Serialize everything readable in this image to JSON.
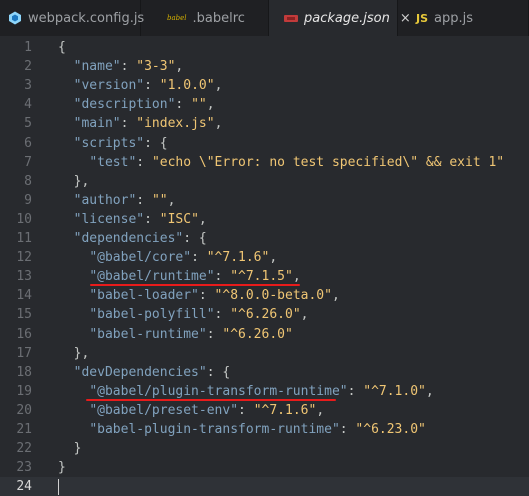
{
  "tabs": [
    {
      "label": "webpack.config.js",
      "icon": "webpack-icon",
      "active": false
    },
    {
      "label": ".babelrc",
      "icon": "babel-icon",
      "icon_text": "babel",
      "active": false
    },
    {
      "label": "package.json",
      "icon": "package-icon",
      "active": true,
      "close": "×"
    },
    {
      "label": "app.js",
      "icon": "js-icon",
      "icon_text": "JS",
      "active": false
    }
  ],
  "editor": {
    "current_line": 24,
    "lines": [
      {
        "n": "1",
        "parts": [
          [
            "p",
            "{"
          ]
        ]
      },
      {
        "n": "2",
        "parts": [
          [
            "p",
            "  "
          ],
          [
            "k",
            "\"name\""
          ],
          [
            "p",
            ": "
          ],
          [
            "s",
            "\"3-3\""
          ],
          [
            "p",
            ","
          ]
        ]
      },
      {
        "n": "3",
        "parts": [
          [
            "p",
            "  "
          ],
          [
            "k",
            "\"version\""
          ],
          [
            "p",
            ": "
          ],
          [
            "s",
            "\"1.0.0\""
          ],
          [
            "p",
            ","
          ]
        ]
      },
      {
        "n": "4",
        "parts": [
          [
            "p",
            "  "
          ],
          [
            "k",
            "\"description\""
          ],
          [
            "p",
            ": "
          ],
          [
            "s",
            "\"\""
          ],
          [
            "p",
            ","
          ]
        ]
      },
      {
        "n": "5",
        "parts": [
          [
            "p",
            "  "
          ],
          [
            "k",
            "\"main\""
          ],
          [
            "p",
            ": "
          ],
          [
            "s",
            "\"index.js\""
          ],
          [
            "p",
            ","
          ]
        ]
      },
      {
        "n": "6",
        "parts": [
          [
            "p",
            "  "
          ],
          [
            "k",
            "\"scripts\""
          ],
          [
            "p",
            ": {"
          ]
        ]
      },
      {
        "n": "7",
        "parts": [
          [
            "p",
            "    "
          ],
          [
            "k",
            "\"test\""
          ],
          [
            "p",
            ": "
          ],
          [
            "s",
            "\"echo \\\"Error: no test specified\\\" && exit 1\""
          ]
        ]
      },
      {
        "n": "8",
        "parts": [
          [
            "p",
            "  },"
          ]
        ]
      },
      {
        "n": "9",
        "parts": [
          [
            "p",
            "  "
          ],
          [
            "k",
            "\"author\""
          ],
          [
            "p",
            ": "
          ],
          [
            "s",
            "\"\""
          ],
          [
            "p",
            ","
          ]
        ]
      },
      {
        "n": "10",
        "parts": [
          [
            "p",
            "  "
          ],
          [
            "k",
            "\"license\""
          ],
          [
            "p",
            ": "
          ],
          [
            "s",
            "\"ISC\""
          ],
          [
            "p",
            ","
          ]
        ]
      },
      {
        "n": "11",
        "parts": [
          [
            "p",
            "  "
          ],
          [
            "k",
            "\"dependencies\""
          ],
          [
            "p",
            ": {"
          ]
        ]
      },
      {
        "n": "12",
        "parts": [
          [
            "p",
            "    "
          ],
          [
            "k",
            "\"@babel/core\""
          ],
          [
            "p",
            ": "
          ],
          [
            "s",
            "\"^7.1.6\""
          ],
          [
            "p",
            ","
          ]
        ]
      },
      {
        "n": "13",
        "parts": [
          [
            "p",
            "    "
          ],
          [
            "k",
            "\"@babel/runtime\""
          ],
          [
            "p",
            ": "
          ],
          [
            "s",
            "\"^7.1.5\""
          ],
          [
            "p",
            ","
          ]
        ]
      },
      {
        "n": "14",
        "parts": [
          [
            "p",
            "    "
          ],
          [
            "k",
            "\"babel-loader\""
          ],
          [
            "p",
            ": "
          ],
          [
            "s",
            "\"^8.0.0-beta.0\""
          ],
          [
            "p",
            ","
          ]
        ]
      },
      {
        "n": "15",
        "parts": [
          [
            "p",
            "    "
          ],
          [
            "k",
            "\"babel-polyfill\""
          ],
          [
            "p",
            ": "
          ],
          [
            "s",
            "\"^6.26.0\""
          ],
          [
            "p",
            ","
          ]
        ]
      },
      {
        "n": "16",
        "parts": [
          [
            "p",
            "    "
          ],
          [
            "k",
            "\"babel-runtime\""
          ],
          [
            "p",
            ": "
          ],
          [
            "s",
            "\"^6.26.0\""
          ]
        ]
      },
      {
        "n": "17",
        "parts": [
          [
            "p",
            "  },"
          ]
        ]
      },
      {
        "n": "18",
        "parts": [
          [
            "p",
            "  "
          ],
          [
            "k",
            "\"devDependencies\""
          ],
          [
            "p",
            ": {"
          ]
        ]
      },
      {
        "n": "19",
        "parts": [
          [
            "p",
            "    "
          ],
          [
            "k",
            "\"@babel/plugin-transform-runtime\""
          ],
          [
            "p",
            ": "
          ],
          [
            "s",
            "\"^7.1.0\""
          ],
          [
            "p",
            ","
          ]
        ]
      },
      {
        "n": "20",
        "parts": [
          [
            "p",
            "    "
          ],
          [
            "k",
            "\"@babel/preset-env\""
          ],
          [
            "p",
            ": "
          ],
          [
            "s",
            "\"^7.1.6\""
          ],
          [
            "p",
            ","
          ]
        ]
      },
      {
        "n": "21",
        "parts": [
          [
            "p",
            "    "
          ],
          [
            "k",
            "\"babel-plugin-transform-runtime\""
          ],
          [
            "p",
            ": "
          ],
          [
            "s",
            "\"^6.23.0\""
          ]
        ]
      },
      {
        "n": "22",
        "parts": [
          [
            "p",
            "  }"
          ]
        ]
      },
      {
        "n": "23",
        "parts": [
          [
            "p",
            "}"
          ]
        ]
      },
      {
        "n": "24",
        "parts": []
      }
    ]
  },
  "colors": {
    "background": "#282a2e",
    "tabbar": "#1f2023",
    "key": "#81a2be",
    "string": "#f0c674",
    "punctuation": "#c5c8c6",
    "annotation": "#e81b1b"
  }
}
